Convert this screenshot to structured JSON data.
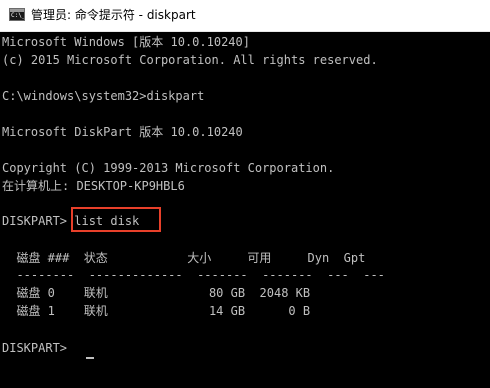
{
  "window": {
    "title": "管理员: 命令提示符 - diskpart",
    "icon_label": "C:\\_"
  },
  "console": {
    "line_version": "Microsoft Windows [版本 10.0.10240]",
    "line_copyright_ms": "(c) 2015 Microsoft Corporation. All rights reserved.",
    "line_prompt_cmd": "C:\\windows\\system32>diskpart",
    "line_diskpart_version": "Microsoft DiskPart 版本 10.0.10240",
    "line_diskpart_copyright": "Copyright (C) 1999-2013 Microsoft Corporation.",
    "line_computer": "在计算机上: DESKTOP-KP9HBL6",
    "prompt": "DISKPART> ",
    "command": "list disk",
    "table_header": "  磁盘 ###  状态           大小     可用     Dyn  Gpt",
    "table_separator": "  --------  -------------  -------  -------  ---  ---",
    "table_rows": [
      "  磁盘 0    联机              80 GB  2048 KB",
      "  磁盘 1    联机              14 GB      0 B"
    ],
    "final_prompt": "DISKPART>"
  },
  "colors": {
    "console_background": "#000000",
    "console_text": "#c0c0c0",
    "highlight_box": "#e8402a"
  }
}
